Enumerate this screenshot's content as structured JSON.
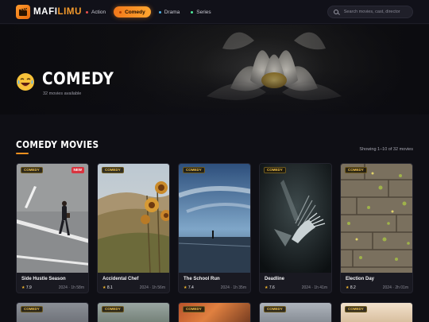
{
  "brand": {
    "name_a": "MAFI",
    "name_b": "LIMU",
    "logo_icon": "clapperboard-icon"
  },
  "nav": {
    "links": [
      {
        "label": "Action",
        "dot_color": "#e94f4f",
        "active": false
      },
      {
        "label": "Comedy",
        "dot_color": "#1b0d00",
        "active": true
      },
      {
        "label": "Drama",
        "dot_color": "#4fb3e9",
        "active": false
      },
      {
        "label": "Series",
        "dot_color": "#4fe99a",
        "active": false
      }
    ]
  },
  "search": {
    "placeholder": "Search movies, cast, director",
    "value": ""
  },
  "hero": {
    "emoji": "laughing-face",
    "title": "COMEDY",
    "subtitle": "32 movies available"
  },
  "section": {
    "title": "COMEDY MOVIES",
    "showing": "Showing 1–10 of 32 movies"
  },
  "colors": {
    "accent": "#f5901f",
    "tag": "#f0c14a",
    "new_badge": "#d9343f",
    "star": "#f5b82e"
  },
  "movies": [
    {
      "tag": "COMEDY",
      "badge": "NEW",
      "title": "Side Hustle Season",
      "rating": "7.9",
      "meta": "2024 · 1h 58m"
    },
    {
      "tag": "COMEDY",
      "badge": "",
      "title": "Accidental Chef",
      "rating": "8.1",
      "meta": "2024 · 1h 56m"
    },
    {
      "tag": "COMEDY",
      "badge": "",
      "title": "The School Run",
      "rating": "7.4",
      "meta": "2024 · 1h 35m"
    },
    {
      "tag": "COMEDY",
      "badge": "",
      "title": "Deadline",
      "rating": "7.6",
      "meta": "2024 · 1h 41m"
    },
    {
      "tag": "COMEDY",
      "badge": "",
      "title": "Election Day",
      "rating": "8.2",
      "meta": "2024 · 2h 01m"
    }
  ],
  "movies_row2": [
    {
      "tag": "COMEDY"
    },
    {
      "tag": "COMEDY"
    },
    {
      "tag": "COMEDY"
    },
    {
      "tag": "COMEDY"
    },
    {
      "tag": "COMEDY"
    }
  ]
}
